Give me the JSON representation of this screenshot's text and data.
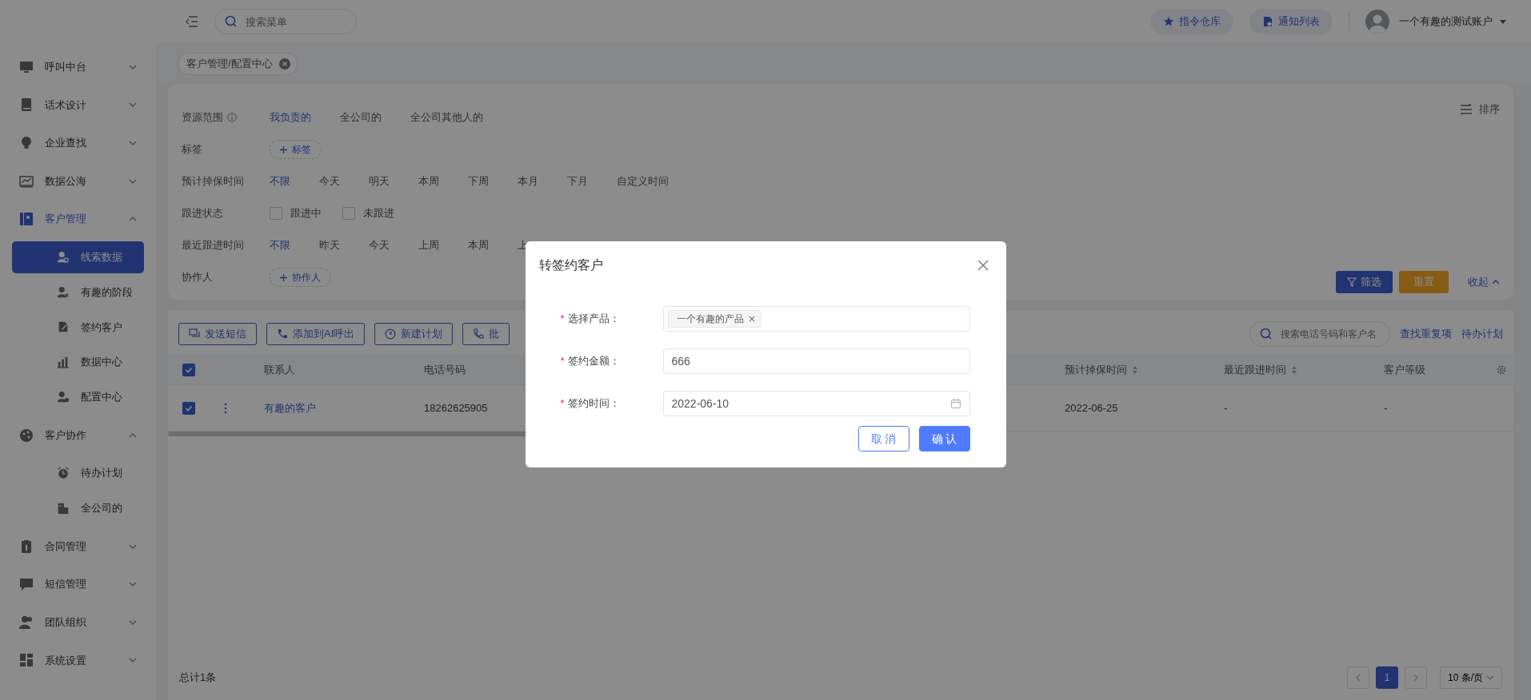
{
  "topbar": {
    "search": {
      "placeholder": "搜索菜单"
    },
    "buttons": [
      {
        "label": "指令仓库"
      },
      {
        "label": "通知列表"
      }
    ],
    "account": {
      "name": "一个有趣的测试账户"
    }
  },
  "sidebar": {
    "items": [
      {
        "label": "呼叫中台",
        "expanded": false,
        "selected": false
      },
      {
        "label": "话术设计",
        "expanded": false,
        "selected": false
      },
      {
        "label": "企业查找",
        "expanded": false,
        "selected": false
      },
      {
        "label": "数据公海",
        "expanded": false,
        "selected": false
      },
      {
        "label": "客户管理",
        "expanded": true,
        "selected": true,
        "children": [
          {
            "label": "线索数据",
            "selected": true
          },
          {
            "label": "有趣的阶段",
            "selected": false
          },
          {
            "label": "签约客户",
            "selected": false
          },
          {
            "label": "数据中心",
            "selected": false
          },
          {
            "label": "配置中心",
            "selected": false
          }
        ]
      },
      {
        "label": "客户协作",
        "expanded": true,
        "selected": false,
        "children": [
          {
            "label": "待办计划",
            "selected": false
          },
          {
            "label": "全公司的",
            "selected": false
          }
        ]
      },
      {
        "label": "合同管理",
        "expanded": false,
        "selected": false
      },
      {
        "label": "短信管理",
        "expanded": false,
        "selected": false
      },
      {
        "label": "团队组织",
        "expanded": false,
        "selected": false
      },
      {
        "label": "系统设置",
        "expanded": false,
        "selected": false
      }
    ]
  },
  "tabs": [
    {
      "label": "客户管理/配置中心"
    }
  ],
  "filters": {
    "rows": [
      {
        "kind": "options",
        "label": "资源范围",
        "info": true,
        "options": [
          {
            "label": "我负责的",
            "selected": true
          },
          {
            "label": "全公司的",
            "selected": false
          },
          {
            "label": "全公司其他人的",
            "selected": false
          }
        ]
      },
      {
        "kind": "add",
        "label": "标签",
        "info": false,
        "button": "标签"
      },
      {
        "kind": "options",
        "label": "预计掉保时间",
        "info": false,
        "options": [
          {
            "label": "不限",
            "selected": true
          },
          {
            "label": "今天",
            "selected": false
          },
          {
            "label": "明天",
            "selected": false
          },
          {
            "label": "本周",
            "selected": false
          },
          {
            "label": "下周",
            "selected": false
          },
          {
            "label": "本月",
            "selected": false
          },
          {
            "label": "下月",
            "selected": false
          },
          {
            "label": "自定义时间",
            "selected": false
          }
        ]
      },
      {
        "kind": "checks",
        "label": "跟进状态",
        "info": false,
        "options": [
          {
            "label": "跟进中",
            "checked": false
          },
          {
            "label": "未跟进",
            "checked": false
          }
        ]
      },
      {
        "kind": "options",
        "label": "最近跟进时间",
        "info": false,
        "options": [
          {
            "label": "不限",
            "selected": true
          },
          {
            "label": "昨天",
            "selected": false
          },
          {
            "label": "今天",
            "selected": false
          },
          {
            "label": "上周",
            "selected": false
          },
          {
            "label": "本周",
            "selected": false
          },
          {
            "label": "上",
            "selected": false
          }
        ]
      },
      {
        "kind": "add",
        "label": "协作人",
        "info": false,
        "button": "协作人"
      }
    ],
    "sort": {
      "label": "排序"
    },
    "actions": [
      {
        "kind": "primary",
        "label": "筛选"
      },
      {
        "kind": "warning",
        "label": "重置"
      },
      {
        "kind": "link",
        "label": "收起"
      }
    ]
  },
  "toolbar": {
    "buttons": [
      {
        "label": "发送短信"
      },
      {
        "label": "添加到AI呼出"
      },
      {
        "label": "新建计划"
      },
      {
        "label": "批"
      }
    ],
    "search": {
      "placeholder": "搜索电话号码和客户名"
    },
    "links": [
      {
        "label": "查找重复项"
      },
      {
        "label": "待办计划"
      }
    ]
  },
  "table": {
    "all_checked": true,
    "columns": [
      {
        "label": "联系人",
        "sortable": false
      },
      {
        "label": "电话号码",
        "sortable": false
      },
      {
        "label": "预计掉保时间",
        "sortable": true
      },
      {
        "label": "最近跟进时间",
        "sortable": true
      },
      {
        "label": "客户等级",
        "sortable": false
      }
    ],
    "rows": [
      {
        "checked": true,
        "cells": [
          "有趣的客户",
          "18262625905",
          "2022-06-25",
          "-",
          "-"
        ]
      }
    ]
  },
  "footer": {
    "total": "总计1条",
    "pages": [
      {
        "label": "1",
        "selected": true
      }
    ],
    "page_size": "10 条/页"
  },
  "modal": {
    "title": "转签约客户",
    "fields": [
      {
        "kind": "tags",
        "required_mark": "*",
        "label": "选择产品：",
        "tags": [
          "一个有趣的产品"
        ]
      },
      {
        "kind": "input",
        "required_mark": "*",
        "label": "签约金额：",
        "value": "666"
      },
      {
        "kind": "date",
        "required_mark": "*",
        "label": "签约时间：",
        "value": "2022-06-10"
      }
    ],
    "buttons": [
      {
        "kind": "secondary",
        "label": "取 消"
      },
      {
        "kind": "primary",
        "label": "确 认"
      }
    ]
  }
}
